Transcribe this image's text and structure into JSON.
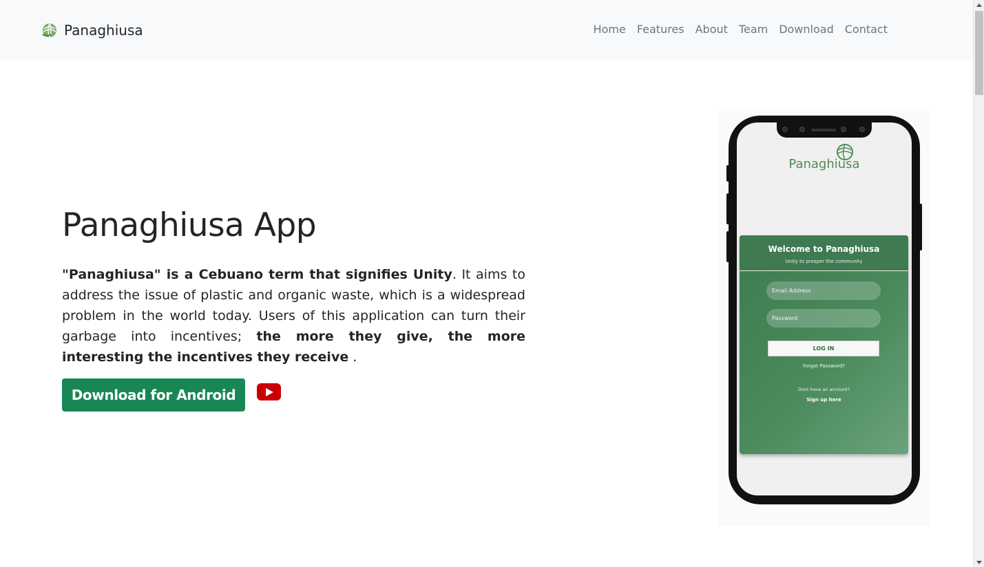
{
  "navbar": {
    "brand": "Panaghiusa",
    "brand_icon": "leaf-globe-icon",
    "links": [
      "Home",
      "Features",
      "About",
      "Team",
      "Download",
      "Contact"
    ]
  },
  "hero": {
    "title": "Panaghiusa App",
    "description": {
      "bold_start": "\"Panaghiusa\" is a Cebuano term that signifies Unity",
      "middle": ". It aims to address the issue of plastic and organic waste, which is a widespread problem in the world today. Users of this application can turn their garbage into incentives; ",
      "bold_end": "the more they give, the more interesting the incentives they receive",
      "end": " ."
    },
    "download_label": "Download for Android",
    "video_icon": "youtube-play-icon"
  },
  "phone": {
    "app_name": "Panaghiusa",
    "card_title": "Welcome to Panaghiusa",
    "card_subtitle": "Unity to prosper the community",
    "email_placeholder": "Email Address",
    "password_placeholder": "Password",
    "login_label": "LOG IN",
    "forgot_label": "Forgot Password?",
    "no_account_label": "Dont have an account?",
    "signup_label": "Sign up here"
  },
  "colors": {
    "primary": "#198754",
    "brand_green": "#4f8a4f",
    "card_green": "#3f7a50",
    "youtube_red": "#cc0000"
  }
}
